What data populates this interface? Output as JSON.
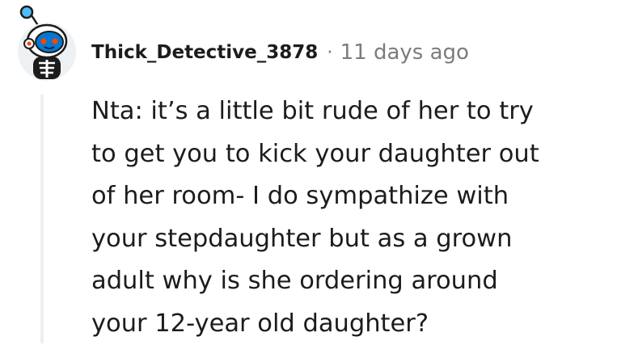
{
  "comment": {
    "username": "Thick_Detective_3878",
    "separator": "·",
    "timestamp": "11 days ago",
    "body_lines": [
      "Nta: it’s a little bit rude of her to try",
      "to get you to kick your daughter out",
      "of her room- I do sympathize with",
      "your stepdaughter but as a grown",
      "adult why is she ordering around",
      "your 12-year old daughter?"
    ]
  },
  "colors": {
    "text": "#1c1c1c",
    "meta": "#7c7c7c",
    "thread_line": "#edeff1",
    "avatar_accent": "#0079d3",
    "avatar_highlight": "#ff4500"
  },
  "icons": {
    "avatar": "snoo-astronaut-avatar-icon"
  }
}
